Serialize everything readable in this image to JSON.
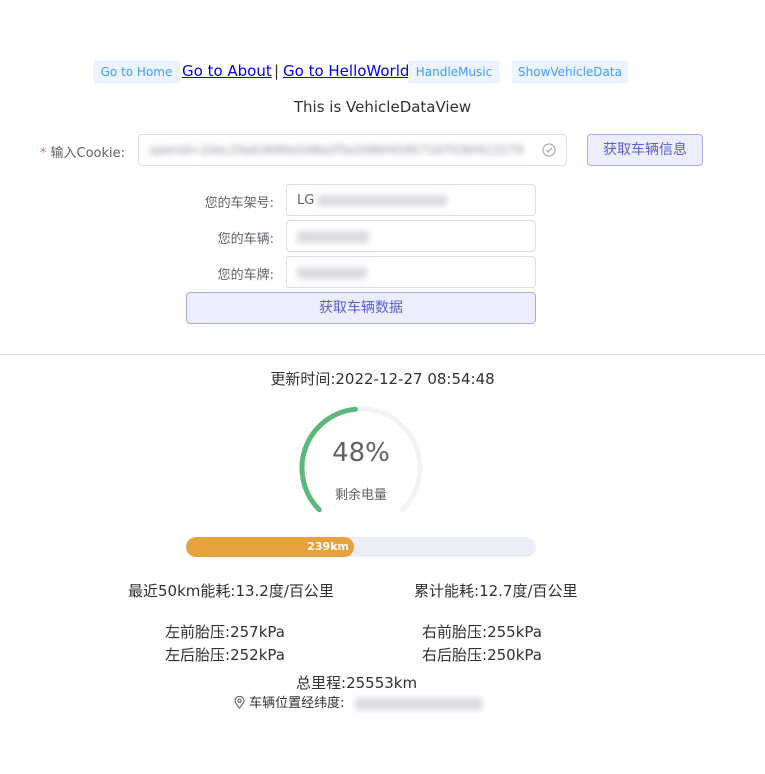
{
  "nav": {
    "home_label": "Go to Home",
    "about_label": "Go to About",
    "separator": "|",
    "helloworld_label": "Go to HelloWorld",
    "music_label": "HandleMusic",
    "vehicle_data_label": "ShowVehicleData"
  },
  "view_title": "This is VehicleDataView",
  "cookie": {
    "required_mark": "*",
    "label": "输入Cookie:",
    "value": "openid=10ec29a63690e548a2f5e208bf4595716703bf413279",
    "status_icon": "check-circle-icon"
  },
  "fetch_info_button": "获取车辆信息",
  "vehicle_fields": {
    "vin_label": "您的车架号:",
    "vin_value": "LG",
    "model_label": "您的车辆:",
    "plate_label": "您的车牌:"
  },
  "fetch_data_button": "获取车辆数据",
  "update": {
    "label": "更新时间:",
    "value": "2022-12-27 08:54:48"
  },
  "battery": {
    "percent": 48,
    "percent_text": "48%",
    "label": "剩余电量",
    "color": "#5cb87a"
  },
  "range": {
    "text": "239km",
    "fill_fraction": 0.48,
    "color": "#e6a23c"
  },
  "consumption": {
    "recent_label": "最近50km能耗:",
    "recent_value": "13.2度/百公里",
    "total_label": "累计能耗:",
    "total_value": "12.7度/百公里"
  },
  "tires": {
    "front_left_label": "左前胎压:",
    "front_left_value": "257kPa",
    "front_right_label": "右前胎压:",
    "front_right_value": "255kPa",
    "rear_left_label": "左后胎压:",
    "rear_left_value": "252kPa",
    "rear_right_label": "右后胎压:",
    "rear_right_value": "250kPa"
  },
  "mileage": {
    "label": "总里程:",
    "value": "25553km"
  },
  "location": {
    "icon": "location-pin-icon",
    "label": "车辆位置经纬度:"
  }
}
